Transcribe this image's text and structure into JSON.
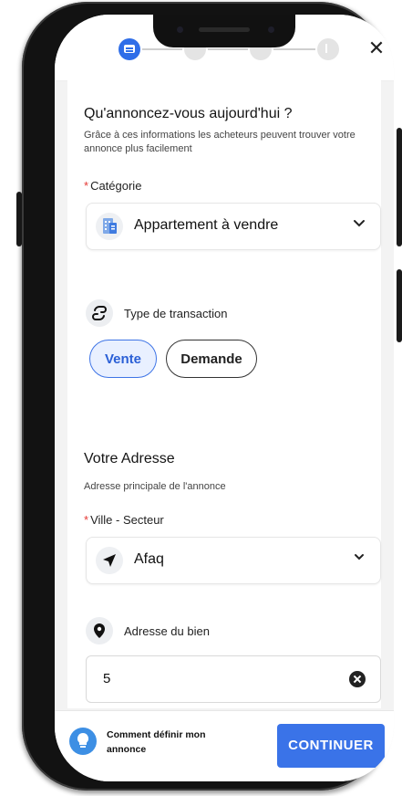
{
  "stepper": {
    "steps": [
      {
        "name": "step-1-details",
        "active": true
      },
      {
        "name": "step-2",
        "active": false
      },
      {
        "name": "step-3",
        "active": false
      },
      {
        "name": "step-4-finish",
        "active": false
      }
    ],
    "close_icon": "close-icon",
    "close_label": "✕"
  },
  "section1": {
    "title": "Qu'annoncez-vous aujourd'hui ?",
    "subtitle": "Grâce à ces informations les acheteurs peuvent trouver votre annonce plus facilement",
    "category": {
      "required_mark": "*",
      "label": "Catégorie",
      "value": "Appartement à vendre",
      "icon": "apartment-icon"
    },
    "transaction": {
      "label": "Type de transaction",
      "icon": "transaction-icon",
      "options": [
        "Vente",
        "Demande"
      ],
      "selected": "Vente"
    }
  },
  "section2": {
    "title": "Votre Adresse",
    "subtitle": "Adresse principale de l'annonce",
    "city": {
      "required_mark": "*",
      "label": "Ville - Secteur",
      "value": "Afaq",
      "icon": "location-arrow-icon"
    },
    "address": {
      "label": "Adresse du bien",
      "icon": "map-pin-icon",
      "value": "5"
    }
  },
  "footer": {
    "help_text": "Comment définir mon annonce",
    "help_icon": "lightbulb-icon",
    "continue_label": "CONTINUER"
  },
  "colors": {
    "accent": "#3a73e8",
    "required": "#e53935",
    "chip_selected_bg": "#e9f0ff"
  }
}
